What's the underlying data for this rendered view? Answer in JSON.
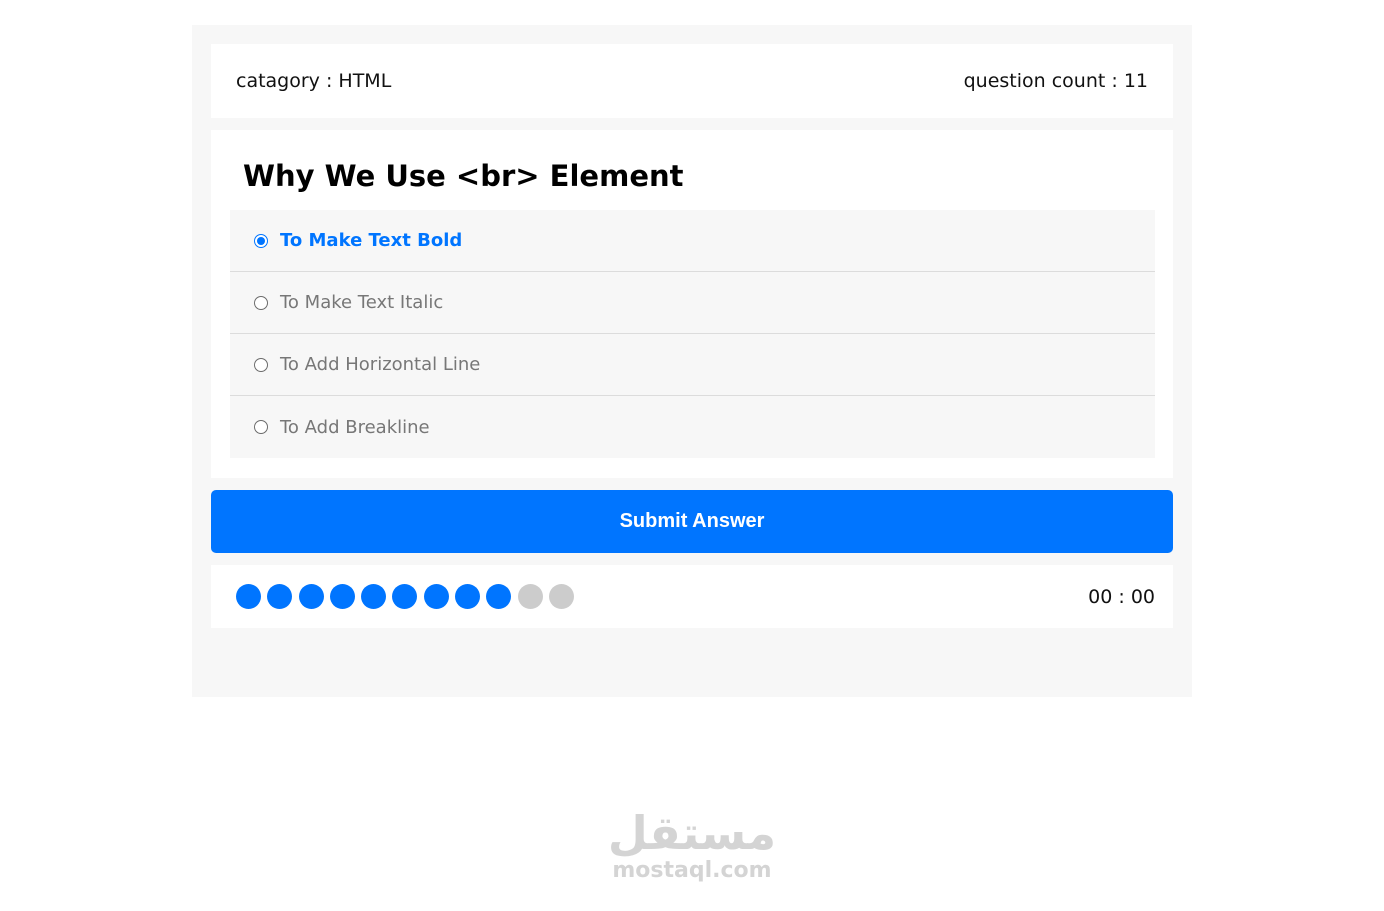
{
  "quiz_info": {
    "category_text": "catagory : HTML",
    "count_text": "question count : 11"
  },
  "question": {
    "title": "Why We Use <br> Element"
  },
  "answers": [
    {
      "label": "To Make Text Bold",
      "selected": true
    },
    {
      "label": "To Make Text Italic",
      "selected": false
    },
    {
      "label": "To Add Horizontal Line",
      "selected": false
    },
    {
      "label": "To Add Breakline",
      "selected": false
    }
  ],
  "submit": {
    "label": "Submit Answer"
  },
  "progress": {
    "total": 11,
    "completed": 9,
    "countdown": "00 : 00"
  },
  "colors": {
    "accent": "#0075ff",
    "inactive_bullet": "#cccccc",
    "panel_bg": "#f7f7f7"
  },
  "watermark": {
    "logo_text": "مستقل",
    "domain_text": "mostaql.com"
  }
}
